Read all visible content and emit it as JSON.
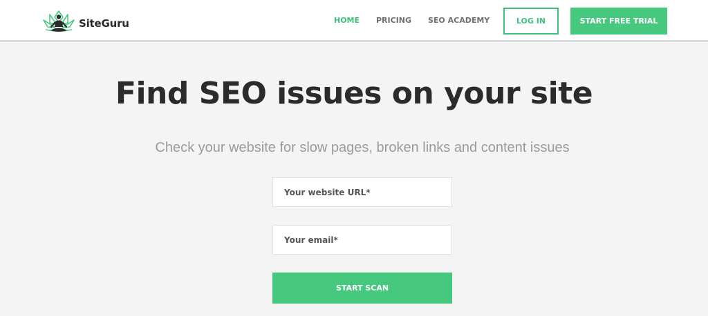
{
  "brand": {
    "name": "SiteGuru",
    "logo_icon": "meditating-figure-lotus-icon",
    "accent": "#46c97f"
  },
  "nav": {
    "items": [
      {
        "label": "HOME",
        "active": true
      },
      {
        "label": "PRICING",
        "active": false
      },
      {
        "label": "SEO ACADEMY",
        "active": false
      }
    ],
    "login_label": "LOG IN",
    "trial_label": "START FREE TRIAL"
  },
  "hero": {
    "title": "Find SEO issues on your site",
    "subtitle": "Check your website for slow pages, broken links and content issues"
  },
  "form": {
    "url_placeholder": "Your website URL*",
    "url_value": "",
    "email_placeholder": "Your email*",
    "email_value": "",
    "submit_label": "START SCAN"
  }
}
